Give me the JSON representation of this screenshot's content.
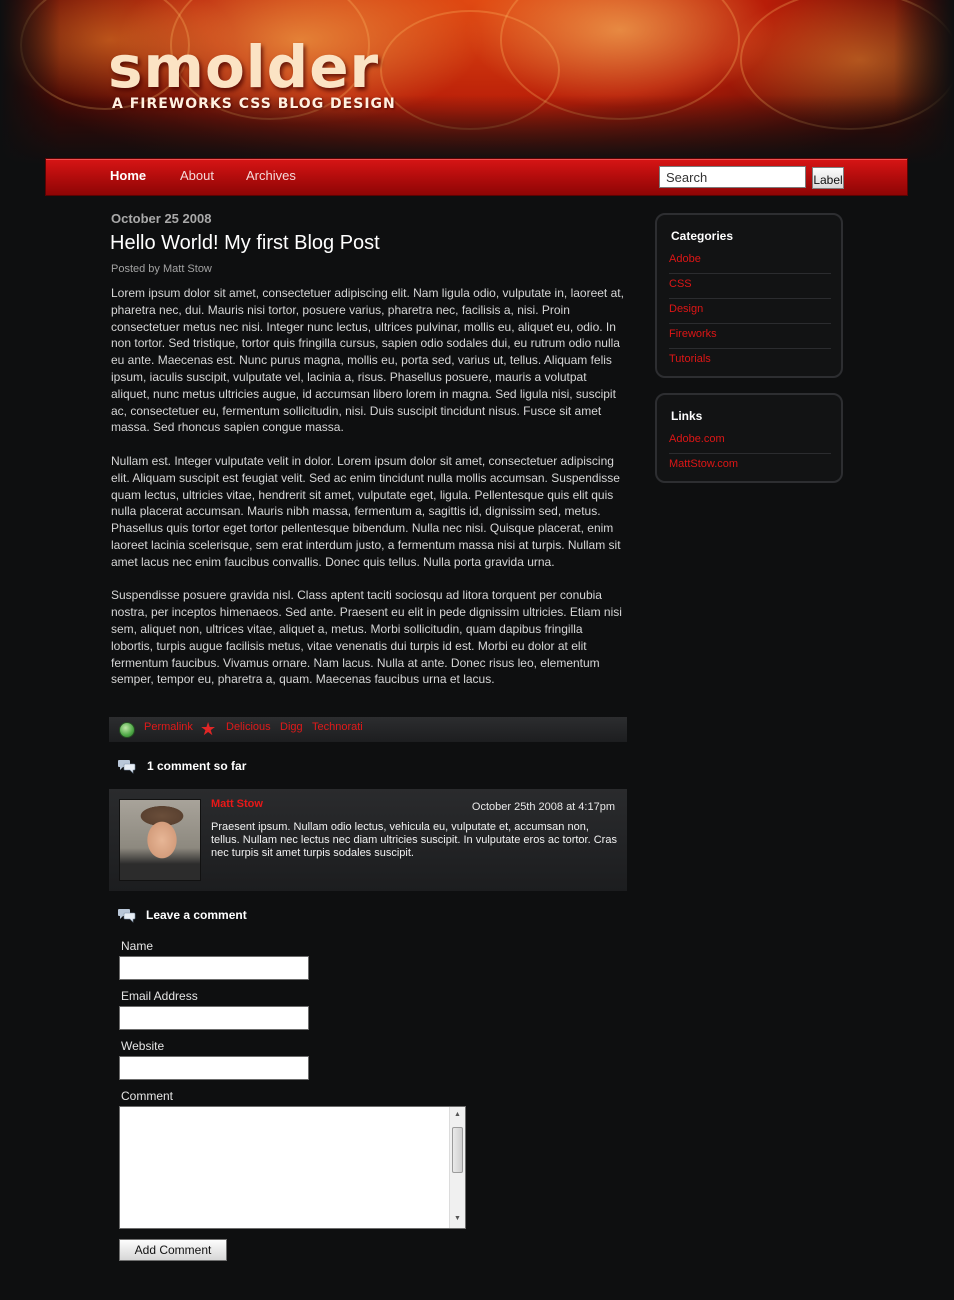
{
  "header": {
    "logo": "smolder",
    "tagline": "A FIREWORKS CSS BLOG DESIGN"
  },
  "nav": {
    "items": [
      {
        "label": "Home",
        "active": true
      },
      {
        "label": "About",
        "active": false
      },
      {
        "label": "Archives",
        "active": false
      }
    ],
    "search_placeholder": "Search",
    "search_button": "Label"
  },
  "post": {
    "date": "October 25 2008",
    "title": "Hello World! My first Blog Post",
    "author": "Posted by Matt Stow",
    "paragraphs": [
      "Lorem ipsum dolor sit amet, consectetuer adipiscing elit. Nam ligula odio, vulputate in, laoreet at, pharetra nec, dui. Mauris nisi tortor, posuere varius, pharetra nec, facilisis a, nisi. Proin consectetuer metus nec nisi. Integer nunc lectus, ultrices pulvinar, mollis eu, aliquet eu, odio. In non tortor. Sed tristique, tortor quis fringilla cursus, sapien odio sodales dui, eu rutrum odio nulla eu ante. Maecenas est. Nunc purus magna, mollis eu, porta sed, varius ut, tellus. Aliquam felis ipsum, iaculis suscipit, vulputate vel, lacinia a, risus. Phasellus posuere, mauris a volutpat aliquet, nunc metus ultricies augue, id accumsan libero lorem in magna. Sed ligula nisi, suscipit ac, consectetuer eu, fermentum sollicitudin, nisi. Duis suscipit tincidunt nisus. Fusce sit amet massa. Sed rhoncus sapien congue massa.",
      "Nullam est. Integer vulputate velit in dolor. Lorem ipsum dolor sit amet, consectetuer adipiscing elit. Aliquam suscipit est feugiat velit. Sed ac enim tincidunt nulla mollis accumsan. Suspendisse quam lectus, ultricies vitae, hendrerit sit amet, vulputate eget, ligula. Pellentesque quis elit quis nulla placerat accumsan. Mauris nibh massa, fermentum a, sagittis id, dignissim sed, metus. Phasellus quis tortor eget tortor pellentesque bibendum. Nulla nec nisi. Quisque placerat, enim laoreet lacinia scelerisque, sem erat interdum justo, a fermentum massa nisi at turpis. Nullam sit amet lacus nec enim faucibus convallis. Donec quis tellus. Nulla porta gravida urna.",
      "Suspendisse posuere gravida nisl. Class aptent taciti sociosqu ad litora torquent per conubia nostra, per inceptos himenaeos. Sed ante. Praesent eu elit in pede dignissim ultricies. Etiam nisi sem, aliquet non, ultrices vitae, aliquet a, metus. Morbi sollicitudin, quam dapibus fringilla lobortis, turpis augue facilisis metus, vitae venenatis dui turpis id est. Morbi eu dolor at elit fermentum faucibus. Vivamus ornare. Nam lacus. Nulla at ante. Donec risus leo, elementum semper, tempor eu, pharetra a, quam. Maecenas faucibus urna et lacus."
    ],
    "meta_links": {
      "permalink": "Permalink",
      "delicious": "Delicious",
      "digg": "Digg",
      "technorati": "Technorati"
    }
  },
  "comments": {
    "heading": "1 comment so far",
    "items": [
      {
        "author": "Matt Stow",
        "date": "October 25th 2008 at 4:17pm",
        "text": "Praesent ipsum. Nullam odio lectus, vehicula eu, vulputate et, accumsan non, tellus. Nullam nec lectus nec diam ultricies suscipit. In vulputate eros ac tortor. Cras nec turpis sit amet turpis sodales suscipit."
      }
    ]
  },
  "comment_form": {
    "heading": "Leave a comment",
    "name_label": "Name",
    "email_label": "Email Address",
    "website_label": "Website",
    "comment_label": "Comment",
    "submit_label": "Add Comment"
  },
  "sidebar": {
    "categories": {
      "title": "Categories",
      "items": [
        "Adobe",
        "CSS",
        "Design",
        "Fireworks",
        "Tutorials"
      ]
    },
    "links": {
      "title": "Links",
      "items": [
        "Adobe.com",
        "MattStow.com"
      ]
    }
  },
  "colors": {
    "accent": "#e01a1a",
    "nav": "#b60d0d",
    "background": "#0e0f10"
  }
}
